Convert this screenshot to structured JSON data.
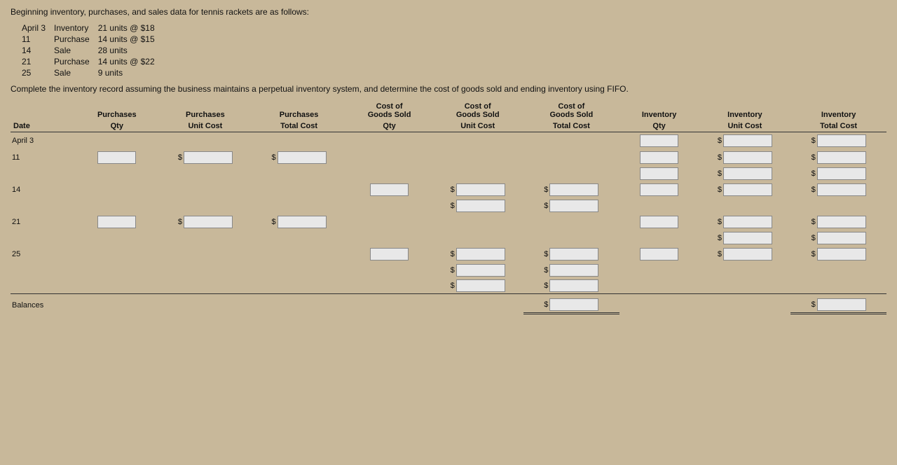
{
  "intro": {
    "line1": "Beginning inventory, purchases, and sales data for tennis rackets are as follows:",
    "items": [
      {
        "col1": "April 3",
        "col2": "Inventory",
        "col3": "21 units @ $18"
      },
      {
        "col1": "11",
        "col2": "Purchase",
        "col3": "14 units @ $15"
      },
      {
        "col1": "14",
        "col2": "Sale",
        "col3": "28 units"
      },
      {
        "col1": "21",
        "col2": "Purchase",
        "col3": "14 units @ $22"
      },
      {
        "col1": "25",
        "col2": "Sale",
        "col3": "9 units"
      }
    ],
    "instruction": "Complete the inventory record assuming the business maintains a perpetual inventory system, and determine the cost of goods sold and ending inventory using FIFO."
  },
  "table": {
    "header": {
      "date": "Date",
      "purchases_qty": "Purchases Qty",
      "purchases_unit_cost": "Purchases Unit Cost",
      "purchases_total_cost": "Purchases Total Cost",
      "cogs_qty": "Cost of Goods Sold Qty",
      "cogs_unit_cost": "Cost of Goods Sold Unit Cost",
      "cogs_total_cost": "Cost of Goods Sold Total Cost",
      "inv_qty": "Inventory Qty",
      "inv_unit_cost": "Inventory Unit Cost",
      "inv_total_cost": "Inventory Total Cost"
    },
    "rows": [
      {
        "date": "April 3"
      },
      {
        "date": "11"
      },
      {
        "date": "14"
      },
      {
        "date": "21"
      },
      {
        "date": "25"
      },
      {
        "date": "Balances"
      }
    ]
  }
}
